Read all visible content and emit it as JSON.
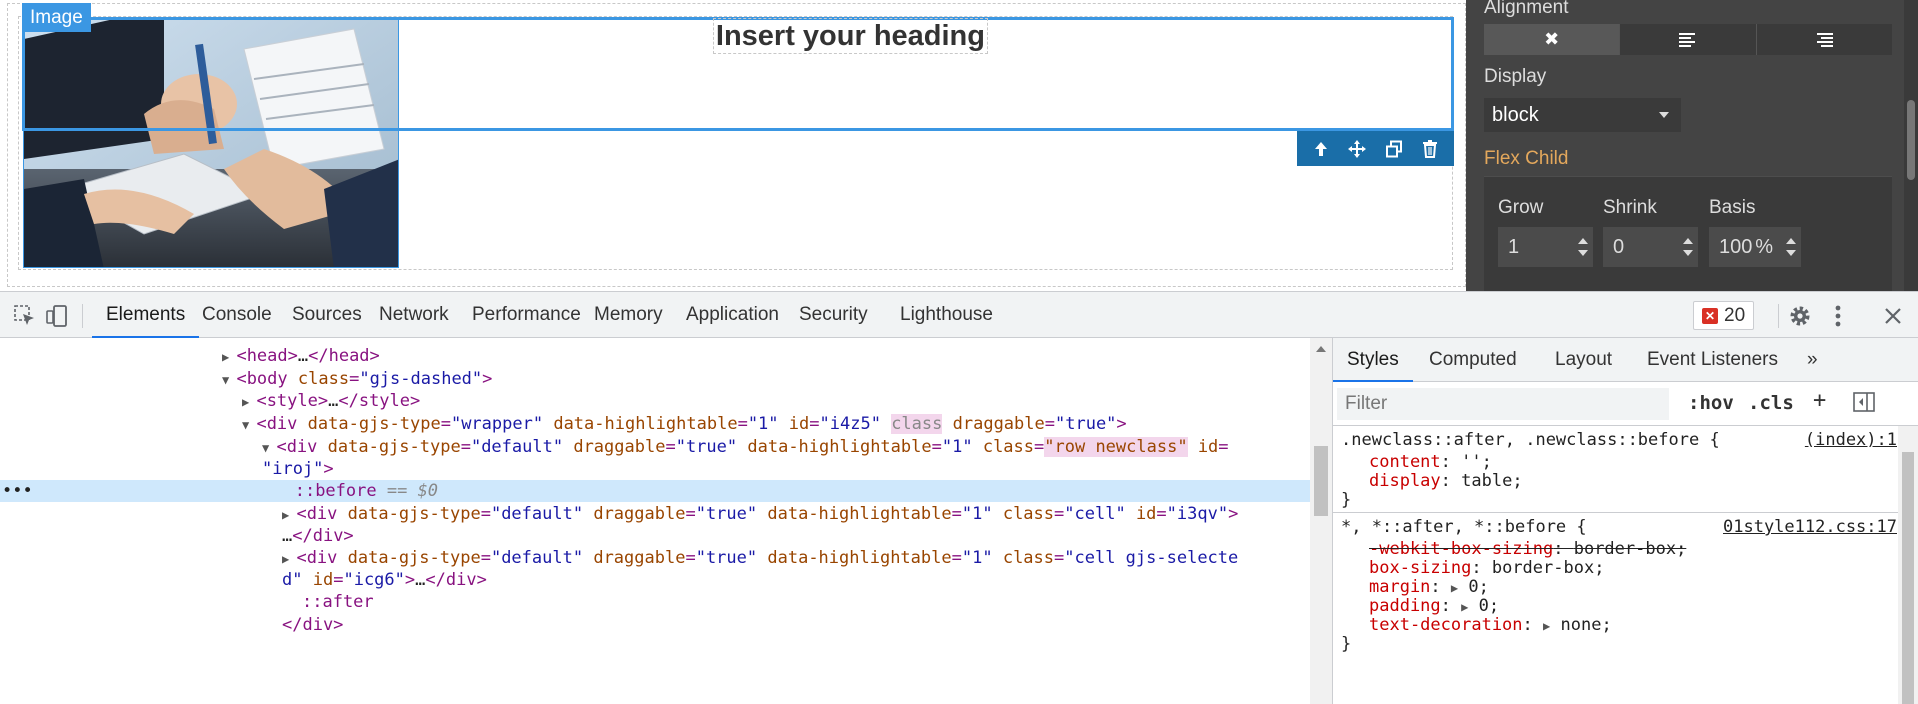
{
  "canvas": {
    "image_badge": "Image",
    "heading_text": "Insert your heading"
  },
  "toolbar": {
    "icons": [
      "arrow-up-icon",
      "move-icon",
      "clone-icon",
      "delete-icon"
    ]
  },
  "style_panel": {
    "alignment_label": "Alignment",
    "alignment_options": [
      "none",
      "left",
      "right"
    ],
    "display_label": "Display",
    "display_value": "block",
    "flex_child_title": "Flex Child",
    "grow_label": "Grow",
    "grow_value": "1",
    "shrink_label": "Shrink",
    "shrink_value": "0",
    "basis_label": "Basis",
    "basis_value": "100",
    "basis_unit": "%",
    "accent_color": "#e4a85c"
  },
  "devtools": {
    "tabs": [
      "Elements",
      "Console",
      "Sources",
      "Network",
      "Performance",
      "Memory",
      "Application",
      "Security",
      "Lighthouse"
    ],
    "active_tab": "Elements",
    "error_count": "20",
    "tree": {
      "head_open": "<head>",
      "head_ellipsis": "…",
      "head_close": "</head>",
      "body_tag": "<body",
      "body_attr": "class",
      "body_val": "\"gjs-dashed\"",
      "style_open": "<style>",
      "style_close": "</style>",
      "wrapper_attr1": "data-gjs-type",
      "wrapper_val1": "\"wrapper\"",
      "wrapper_attr2": "data-highlightable",
      "wrapper_val2": "\"1\"",
      "wrapper_attr3": "id",
      "wrapper_val3": "\"i4z5\"",
      "wrapper_attr4": "class",
      "wrapper_attr5": "draggable",
      "wrapper_val5": "\"true\"",
      "row_attr1": "data-gjs-type",
      "row_val1": "\"default\"",
      "row_attr2": "draggable",
      "row_val2": "\"true\"",
      "row_attr3": "data-highlightable",
      "row_val3": "\"1\"",
      "row_attr4": "class",
      "row_val4": "\"row newclass\"",
      "row_attr5": "id",
      "row_val5_line2": "\"iroj\"",
      "before_text": "::before",
      "before_eq": "== $0",
      "cell1_val_class": "\"cell\"",
      "cell1_val_id": "\"i3qv\"",
      "cell2_val_class_part1": "\"cell gjs-selecte",
      "cell2_val_class_part2": "d\"",
      "cell2_val_id": "\"icg6\"",
      "after_text": "::after",
      "div_close": "</div>",
      "ellipsis": "…"
    },
    "styles_tabs": [
      "Styles",
      "Computed",
      "Layout",
      "Event Listeners"
    ],
    "filter_placeholder": "Filter",
    "hov_label": ":hov",
    "cls_label": ".cls",
    "rule1": {
      "selector": ".newclass::after, .newclass::before {",
      "source": "(index):1",
      "props": [
        {
          "name": "content",
          "value": "'';"
        },
        {
          "name": "display",
          "value": "table;"
        }
      ]
    },
    "rule2": {
      "selector": "*, *::after, *::before {",
      "source": "01style112.css:17",
      "props": [
        {
          "name": "-webkit-box-sizing",
          "value": "border-box;",
          "struck": true
        },
        {
          "name": "box-sizing",
          "value": "border-box;"
        },
        {
          "name": "margin",
          "value": "0;"
        },
        {
          "name": "padding",
          "value": "0;"
        },
        {
          "name": "text-decoration",
          "value": "none;"
        }
      ]
    },
    "closing_brace": "}"
  }
}
